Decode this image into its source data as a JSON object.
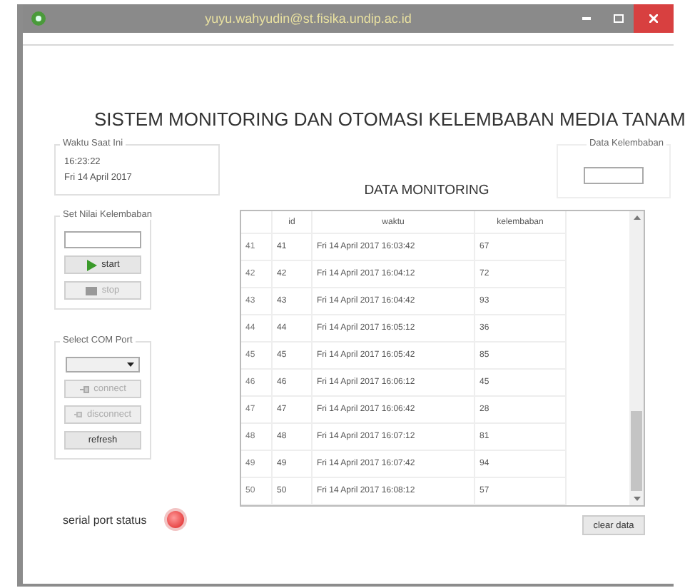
{
  "window": {
    "title": "yuyu.wahyudin@st.fisika.undip.ac.id"
  },
  "heading": "SISTEM MONITORING DAN OTOMASI KELEMBABAN MEDIA TANAM",
  "clock": {
    "label": "Waktu Saat Ini",
    "time": "16:23:22",
    "date": "Fri 14 April 2017"
  },
  "humidity": {
    "label": "Data Kelembaban"
  },
  "setpoint": {
    "label": "Set Nilai Kelembaban",
    "buttons": [
      {
        "label": "start",
        "kind": "start",
        "disabled": false
      },
      {
        "label": "stop",
        "kind": "stop",
        "disabled": true
      }
    ]
  },
  "com_port": {
    "label": "Select COM Port",
    "buttons": [
      {
        "label": "connect",
        "kind": "connect",
        "disabled": true
      },
      {
        "label": "disconnect",
        "kind": "disconnect",
        "disabled": true
      },
      {
        "label": "refresh",
        "kind": "plain",
        "disabled": false
      }
    ]
  },
  "serial_status": {
    "label": "serial port status",
    "connected": false
  },
  "monitoring": {
    "title": "DATA MONITORING",
    "columns": [
      "id",
      "waktu",
      "kelembaban"
    ],
    "rows": [
      {
        "index": "41",
        "id": "41",
        "waktu": "Fri 14 April 2017 16:03:42",
        "kelembaban": "67"
      },
      {
        "index": "42",
        "id": "42",
        "waktu": "Fri 14 April 2017 16:04:12",
        "kelembaban": "72"
      },
      {
        "index": "43",
        "id": "43",
        "waktu": "Fri 14 April 2017 16:04:42",
        "kelembaban": "93"
      },
      {
        "index": "44",
        "id": "44",
        "waktu": "Fri 14 April 2017 16:05:12",
        "kelembaban": "36"
      },
      {
        "index": "45",
        "id": "45",
        "waktu": "Fri 14 April 2017 16:05:42",
        "kelembaban": "85"
      },
      {
        "index": "46",
        "id": "46",
        "waktu": "Fri 14 April 2017 16:06:12",
        "kelembaban": "45"
      },
      {
        "index": "47",
        "id": "47",
        "waktu": "Fri 14 April 2017 16:06:42",
        "kelembaban": "28"
      },
      {
        "index": "48",
        "id": "48",
        "waktu": "Fri 14 April 2017 16:07:12",
        "kelembaban": "81"
      },
      {
        "index": "49",
        "id": "49",
        "waktu": "Fri 14 April 2017 16:07:42",
        "kelembaban": "94"
      },
      {
        "index": "50",
        "id": "50",
        "waktu": "Fri 14 April 2017 16:08:12",
        "kelembaban": "57"
      }
    ]
  },
  "clear_button": "clear data"
}
